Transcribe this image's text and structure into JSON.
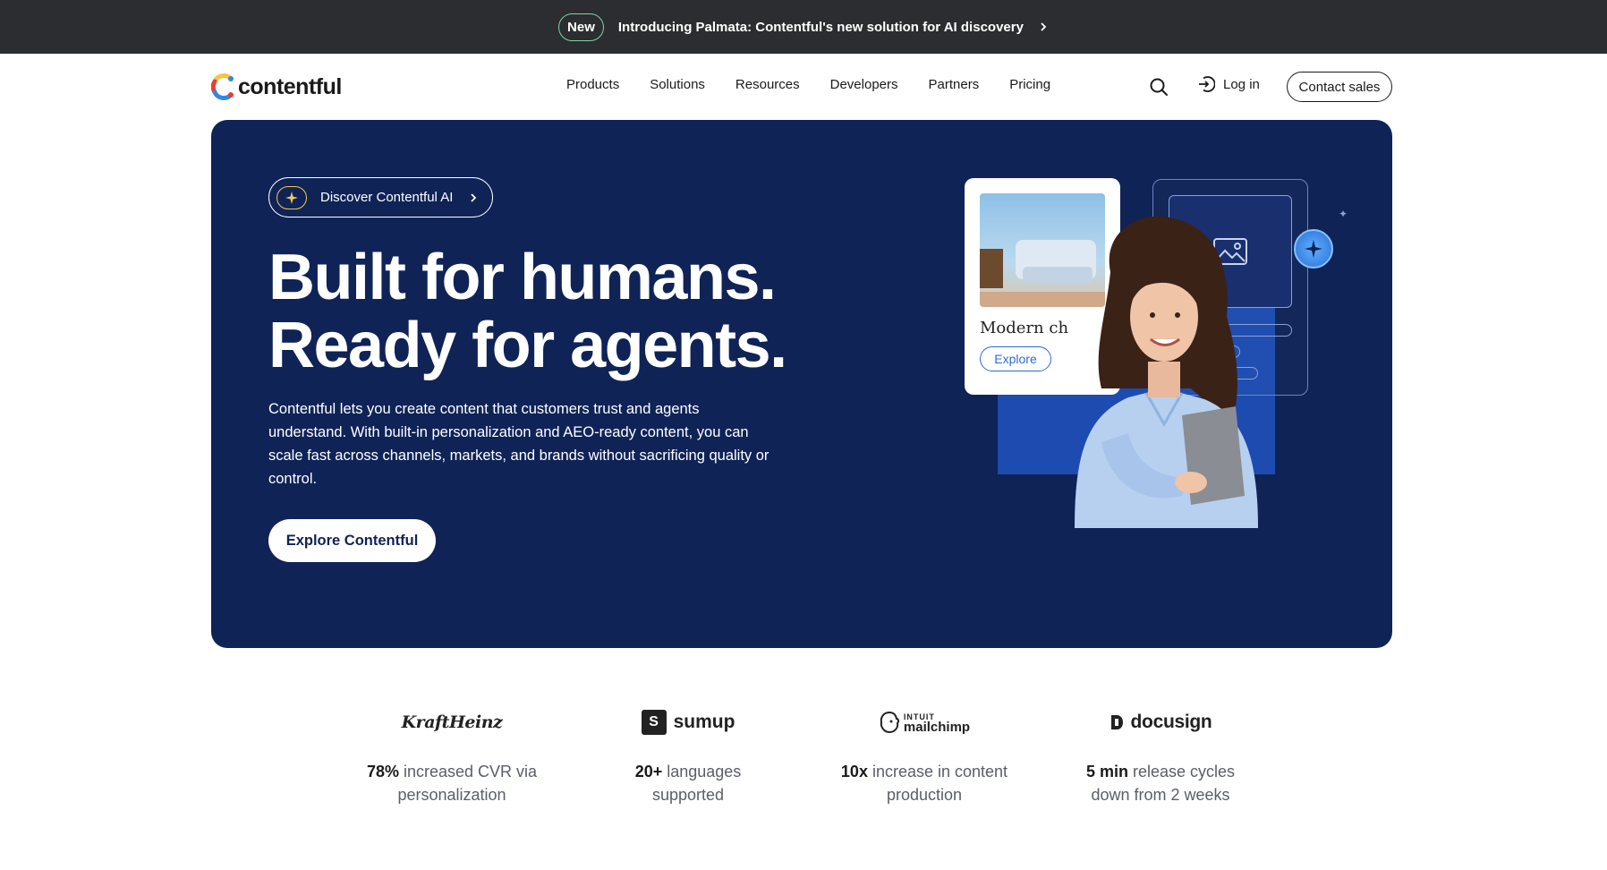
{
  "announcement": {
    "badge": "New",
    "message": "Introducing Palmata: Contentful's new solution for AI discovery"
  },
  "nav": {
    "logo_text": "contentful",
    "menu": [
      "Products",
      "Solutions",
      "Resources",
      "Developers",
      "Partners",
      "Pricing"
    ],
    "login_label": "Log in",
    "contact_label": "Contact sales"
  },
  "hero": {
    "pill_label": "Discover Contentful AI",
    "headline_line1": "Built for humans.",
    "headline_line2": "Ready for agents.",
    "body": "Contentful lets you create content that customers trust and agents understand. With built-in personalization and AEO-ready content, you can scale fast across channels, markets, and brands without sacrificing quality or control.",
    "cta_label": "Explore Contentful",
    "card_title": "Modern ch",
    "card_button": "Explore"
  },
  "stats": [
    {
      "logo": "KraftHeinz",
      "highlight": "78%",
      "rest1": " increased CVR via",
      "rest2": "personalization"
    },
    {
      "logo": "sumup",
      "highlight": "20+",
      "rest1": " languages",
      "rest2": "supported"
    },
    {
      "logo_top": "INTUIT",
      "logo": "mailchimp",
      "highlight": "10x",
      "rest1": " increase in content",
      "rest2": "production"
    },
    {
      "logo": "docusign",
      "highlight": "5 min",
      "rest1": " release cycles",
      "rest2": "down from 2 weeks"
    }
  ],
  "colors": {
    "announce_bg": "#2b2d30",
    "hero_bg": "#0f2357",
    "accent_blue": "#2f6bd6"
  }
}
